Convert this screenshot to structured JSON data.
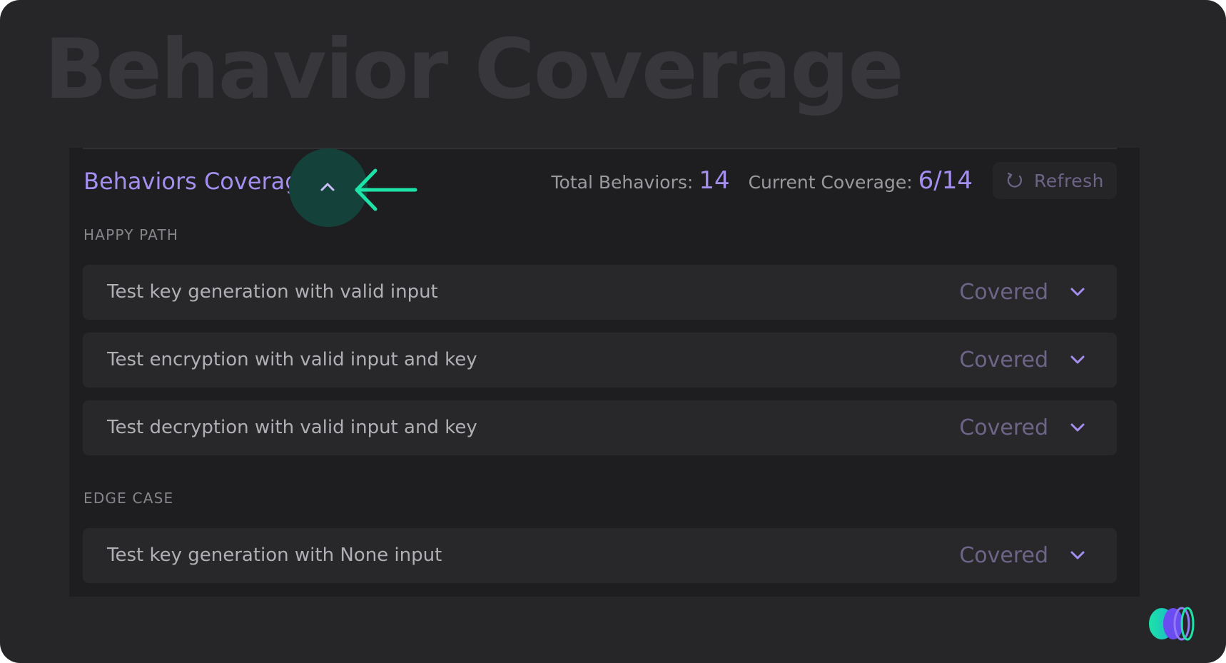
{
  "page": {
    "heading": "Behavior Coverage"
  },
  "panel": {
    "title": "Behaviors Coverage",
    "collapse_icon": "chevron-up-icon",
    "annotation_icon": "arrow-left-icon",
    "stats": {
      "total_label": "Total Behaviors:",
      "total_value": "14",
      "coverage_label": "Current Coverage:",
      "coverage_value": "6/14"
    },
    "refresh": {
      "icon": "refresh-icon",
      "label": "Refresh"
    }
  },
  "sections": [
    {
      "label": "HAPPY PATH",
      "items": [
        {
          "text": "Test key generation with valid input",
          "status": "Covered"
        },
        {
          "text": "Test encryption with valid input and key",
          "status": "Covered"
        },
        {
          "text": "Test decryption with valid input and key",
          "status": "Covered"
        }
      ]
    },
    {
      "label": "EDGE CASE",
      "items": [
        {
          "text": "Test key generation with None input",
          "status": "Covered"
        }
      ]
    }
  ],
  "colors": {
    "accent": "#a48ff0",
    "annotation": "#1de3a8",
    "highlight": "#14423a",
    "status": "#6e6488"
  },
  "logo": {
    "icon": "app-logo-icon"
  }
}
